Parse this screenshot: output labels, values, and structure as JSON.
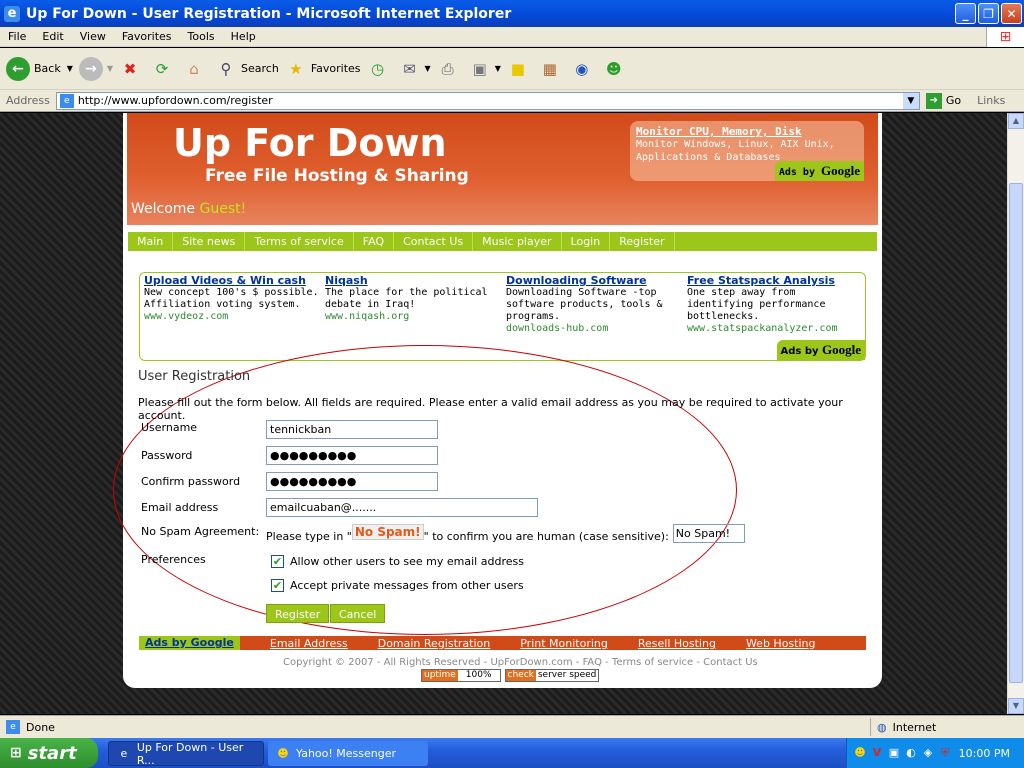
{
  "window": {
    "title": "Up For Down - User Registration - Microsoft Internet Explorer"
  },
  "menu": [
    "File",
    "Edit",
    "View",
    "Favorites",
    "Tools",
    "Help"
  ],
  "toolbar": {
    "back": "Back",
    "search": "Search",
    "favorites": "Favorites"
  },
  "address": {
    "label": "Address",
    "url": "http://www.upfordown.com/register",
    "go": "Go",
    "links": "Links"
  },
  "site": {
    "title": "Up For Down",
    "tagline": "Free File Hosting & Sharing",
    "welcome": "Welcome",
    "guest": "Guest!",
    "top_ad": {
      "title": "Monitor CPU, Memory, Disk",
      "desc": "Monitor Windows, Linux, AIX Unix, Applications & Databases"
    },
    "ads_by": "Ads by",
    "google": "Google"
  },
  "nav": [
    "Main",
    "Site news",
    "Terms of service",
    "FAQ",
    "Contact Us",
    "Music player",
    "Login",
    "Register"
  ],
  "ads": [
    {
      "title": "Upload Videos & Win cash",
      "desc": "New concept 100's $ possible. Affiliation voting system.",
      "url": "www.vydeoz.com"
    },
    {
      "title": "Niqash",
      "desc": "The place for the political debate in Iraq!",
      "url": "www.niqash.org"
    },
    {
      "title": "Downloading Software",
      "desc": "Downloading Software -top software products, tools & programs.",
      "url": "downloads-hub.com"
    },
    {
      "title": "Free Statspack Analysis",
      "desc": "One step away from identifying performance bottlenecks.",
      "url": "www.statspackanalyzer.com"
    }
  ],
  "form": {
    "title": "User Registration",
    "intro": "Please fill out the form below. All fields are required. Please enter a valid email address as you may be required to activate your account.",
    "username_label": "Username",
    "username": "tennickban",
    "password_label": "Password",
    "password": "●●●●●●●●●",
    "confirm_label": "Confirm password",
    "confirm": "●●●●●●●●●",
    "email_label": "Email address",
    "email": "emailcuaban@.......",
    "nospam_label": "No Spam Agreement:",
    "nospam_pre": "Please type in \"",
    "nospam_word": "No Spam!",
    "nospam_post": "\" to confirm you are human (case sensitive):",
    "nospam_value": "No Spam!",
    "prefs_label": "Preferences",
    "pref1": "Allow other users to see my email address",
    "pref2": "Accept private messages from other users",
    "register": "Register",
    "cancel": "Cancel"
  },
  "ad_strip": {
    "label": "Ads by Google",
    "links": [
      "Email Address",
      "Domain Registration",
      "Print Monitoring",
      "Resell Hosting",
      "Web Hosting"
    ]
  },
  "footer": {
    "copyright": "Copyright © 2007 - All Rights Reserved - UpForDown.com - FAQ - Terms of service - Contact Us",
    "uptime_label": "uptime",
    "uptime_value": "100%",
    "check_label": "check",
    "check_value": "server speed"
  },
  "status": {
    "text": "Done",
    "zone": "Internet"
  },
  "taskbar": {
    "start": "start",
    "tasks": [
      "Up For Down - User R...",
      "Yahoo! Messenger"
    ],
    "clock": "10:00 PM"
  }
}
